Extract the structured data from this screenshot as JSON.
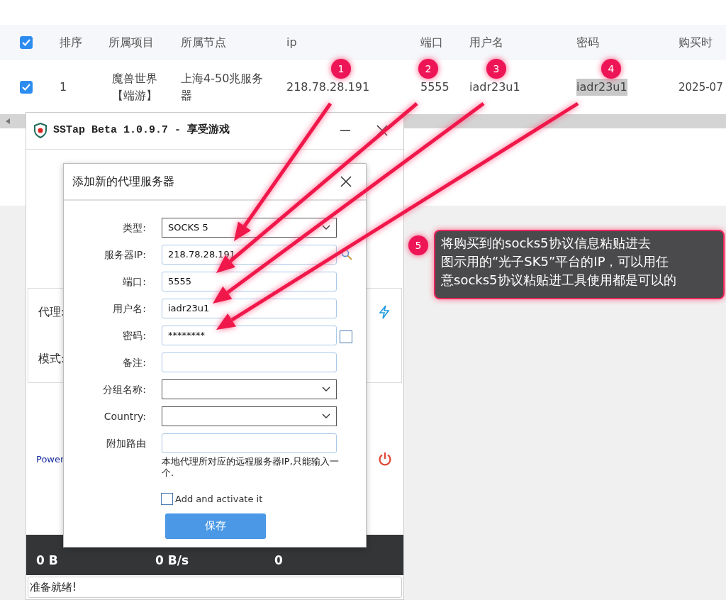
{
  "table": {
    "header_checked": true,
    "columns": [
      "排序",
      "所属项目",
      "所属节点",
      "ip",
      "端口",
      "用户名",
      "密码",
      "购买时"
    ],
    "rows": [
      {
        "checked": true,
        "cells": [
          {
            "text": "1",
            "selected": false
          },
          {
            "text": "魔兽世界【端游】",
            "selected": false
          },
          {
            "text": "上海4-50兆服务器",
            "selected": false
          },
          {
            "text": "218.78.28.191",
            "selected": false
          },
          {
            "text": "5555",
            "selected": false
          },
          {
            "text": "iadr23u1",
            "selected": false
          },
          {
            "text": "iadr23u1",
            "selected": true
          },
          {
            "text": "2025-07",
            "selected": false
          }
        ]
      }
    ]
  },
  "app_window": {
    "title": "SSTap Beta 1.0.9.7 - 享受游戏",
    "proxy_label": "代理:",
    "mode_label": "模式:",
    "link": "Power",
    "stats": [
      "0 B",
      "0 B/s",
      "0"
    ],
    "status": "准备就绪!"
  },
  "dialog": {
    "title": "添加新的代理服务器",
    "fields": [
      {
        "label": "类型:",
        "kind": "select",
        "value": "SOCKS 5"
      },
      {
        "label": "服务器IP:",
        "kind": "input",
        "value": "218.78.28.191",
        "search": true
      },
      {
        "label": "端口:",
        "kind": "input",
        "value": "5555"
      },
      {
        "label": "用户名:",
        "kind": "input",
        "value": "iadr23u1"
      },
      {
        "label": "密码:",
        "kind": "password",
        "value": "********",
        "show_checked": false
      },
      {
        "label": "备注:",
        "kind": "input"
      },
      {
        "label": "分组名称:",
        "kind": "select"
      },
      {
        "label": "Country:",
        "kind": "select"
      },
      {
        "label": "附加路由",
        "kind": "input"
      }
    ],
    "hint": "本地代理所对应的远程服务器IP,只能输入一个.",
    "activate": {
      "label": "Add and activate it",
      "checked": false
    },
    "save_button": "保存"
  },
  "annotations": [
    {
      "label": "1"
    },
    {
      "label": "2"
    },
    {
      "label": "3"
    },
    {
      "label": "4"
    }
  ],
  "callout": {
    "badge": "5",
    "lines": [
      "将购买到的socks5协议信息粘贴进去",
      "图示用的“光子SK5”平台的IP，可以用任",
      "意socks5协议粘贴进工具使用都是可以的"
    ]
  }
}
